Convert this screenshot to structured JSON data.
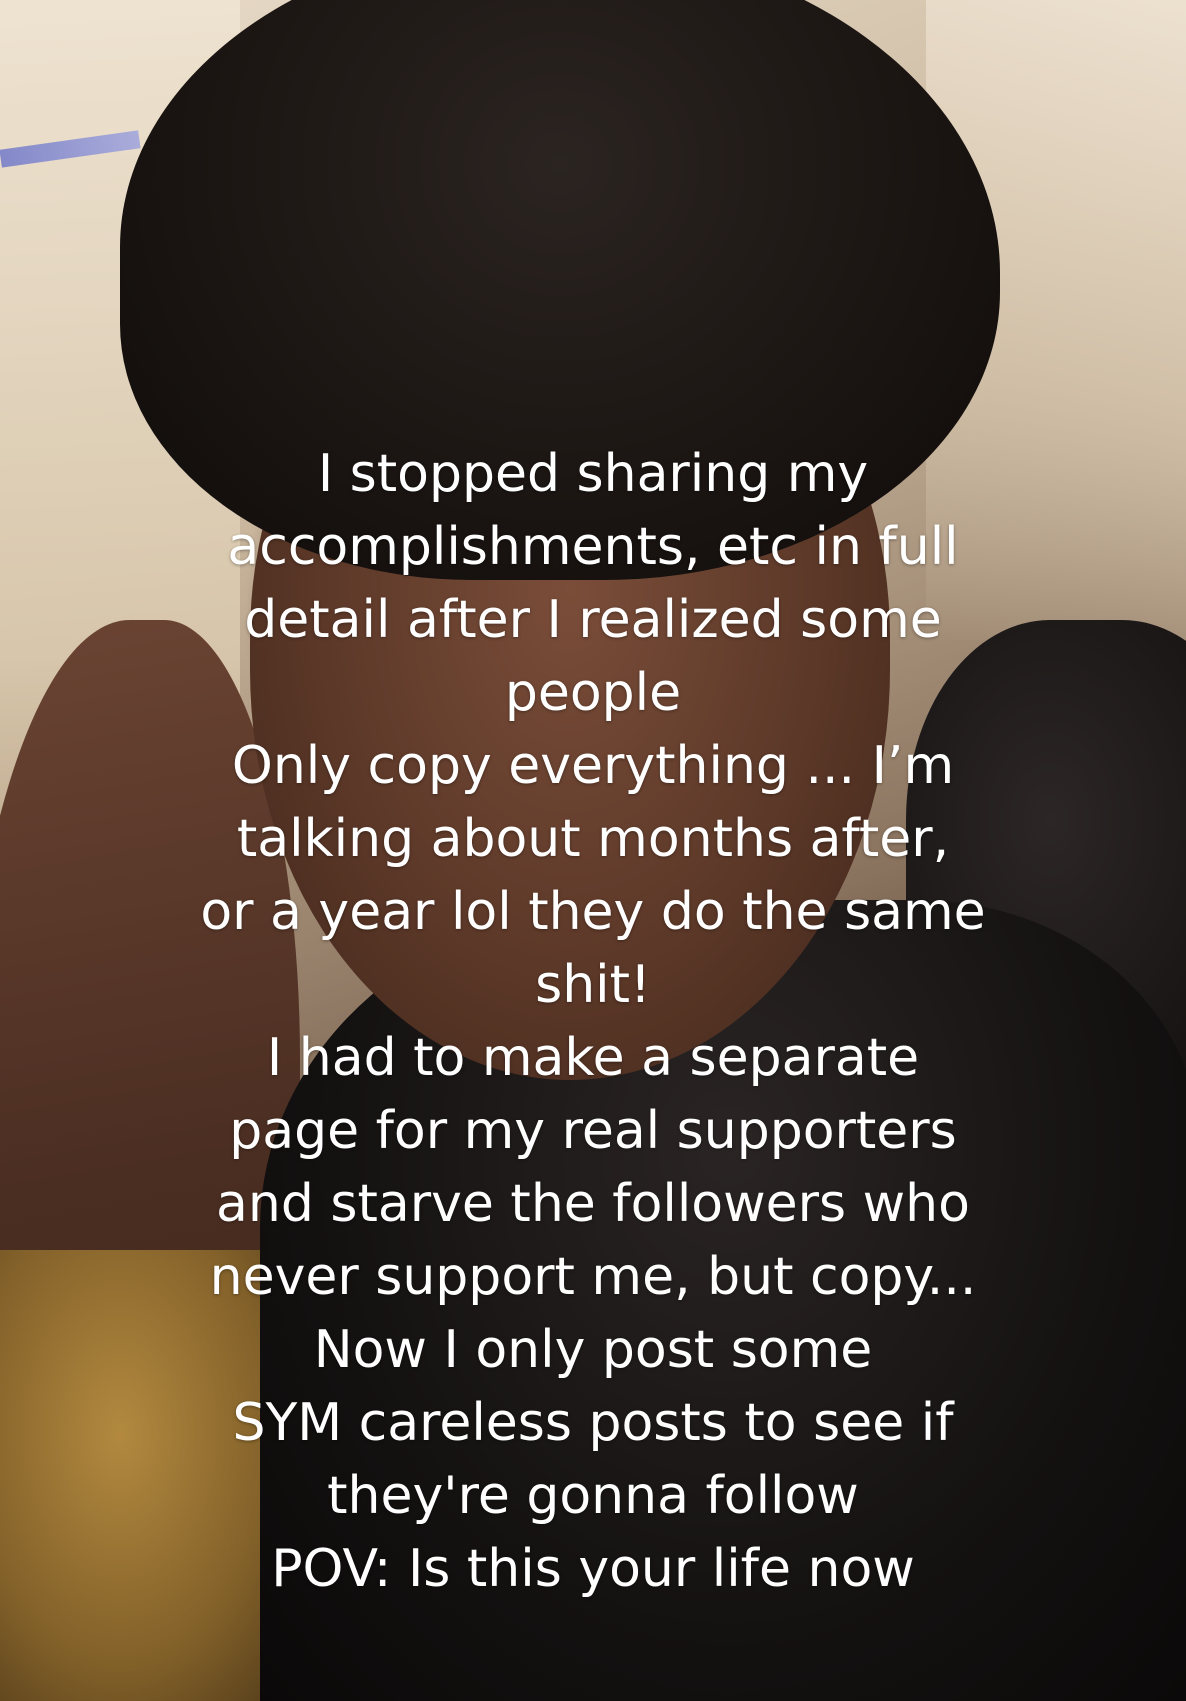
{
  "caption": {
    "lines": [
      "I stopped sharing my",
      "accomplishments, etc in full",
      "detail after I realized some",
      "people",
      "Only copy everything ... I’m",
      "talking about months after,",
      "or a year lol they do the same",
      "shit!",
      "I had to make a separate",
      "page for my real supporters",
      "and starve the followers who",
      "never support me, but copy...",
      "Now I only post some",
      "SYM careless posts to see if",
      "they're gonna follow",
      "POV: Is this your life now"
    ]
  }
}
